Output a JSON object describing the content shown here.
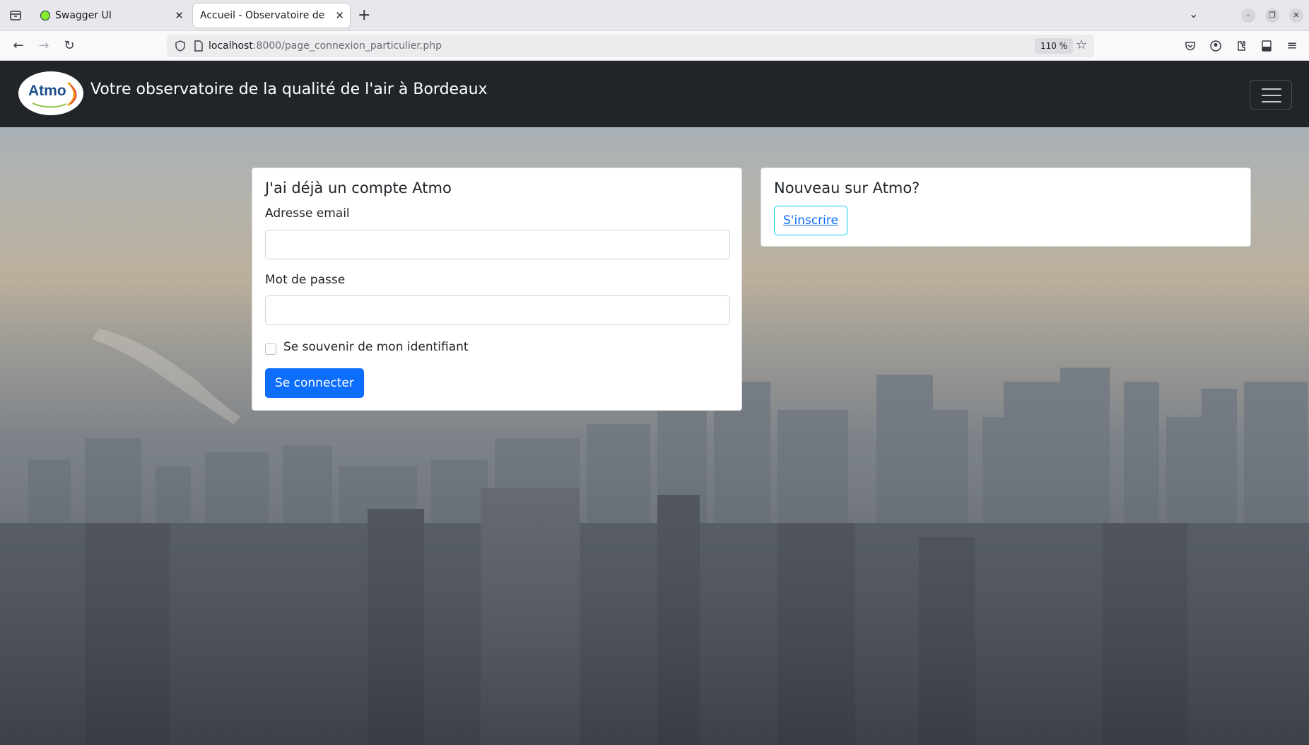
{
  "browser": {
    "tabs": [
      {
        "title": "Swagger UI",
        "active": false
      },
      {
        "title": "Accueil - Observatoire de la q",
        "active": true
      }
    ],
    "url_host": "localhost",
    "url_rest": ":8000/page_connexion_particulier.php",
    "zoom": "110 %"
  },
  "site": {
    "logo_text": "Atmo",
    "title": "Votre observatoire de la qualité de l'air à Bordeaux"
  },
  "login_card": {
    "title": "J'ai déjà un compte Atmo",
    "email_label": "Adresse email",
    "email_value": "",
    "password_label": "Mot de passe",
    "password_value": "",
    "remember_label": "Se souvenir de mon identifiant",
    "remember_checked": false,
    "submit_label": "Se connecter"
  },
  "signup_card": {
    "title": "Nouveau sur Atmo?",
    "signup_label": "S'inscrire"
  },
  "colors": {
    "header_bg": "#212529",
    "primary": "#0d6efd",
    "outline_border": "#0dcaf0"
  }
}
